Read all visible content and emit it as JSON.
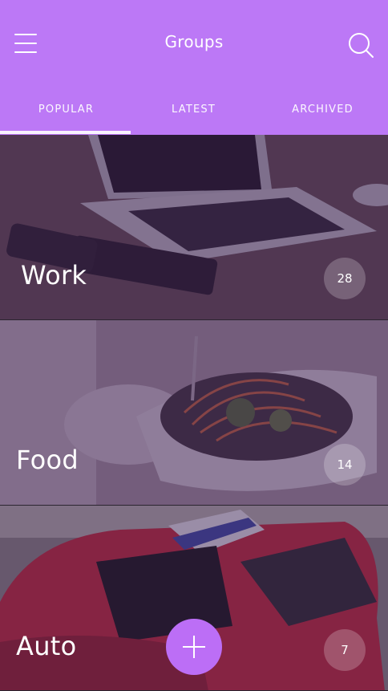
{
  "header": {
    "title": "Groups",
    "menu_icon": "hamburger-menu-icon",
    "search_icon": "search-icon",
    "background": "#bc78f6"
  },
  "tabs": [
    {
      "label": "POPULAR",
      "active": true
    },
    {
      "label": "LATEST",
      "active": false
    },
    {
      "label": "ARCHIVED",
      "active": false
    }
  ],
  "groups": [
    {
      "name": "Work",
      "count": "28",
      "image": "laptop-desk-photo"
    },
    {
      "name": "Food",
      "count": "14",
      "image": "salad-bowl-photo"
    },
    {
      "name": "Auto",
      "count": "7",
      "image": "red-sports-car-photo"
    }
  ],
  "fab": {
    "icon": "plus-icon",
    "color": "#bc6ef6"
  }
}
